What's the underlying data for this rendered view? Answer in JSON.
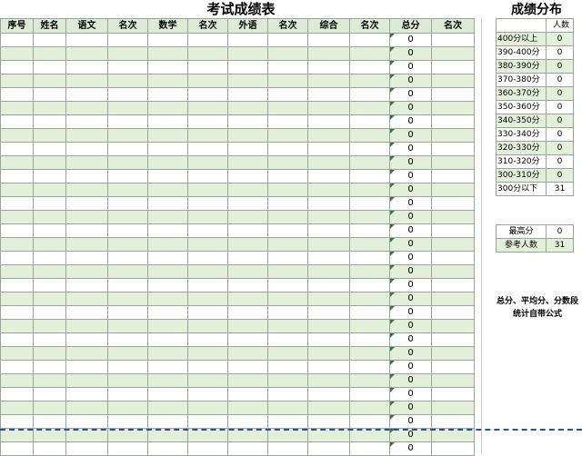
{
  "sheet": {
    "title": "考试成绩表",
    "headers": [
      "序号",
      "姓名",
      "语文",
      "名次",
      "数学",
      "名次",
      "外语",
      "名次",
      "综合",
      "名次",
      "总分",
      "名次"
    ],
    "total_value": "0",
    "row_count": 31
  },
  "distribution": {
    "title": "成绩分布",
    "count_header": "人数",
    "rows": [
      {
        "range": "400分以上",
        "count": "0"
      },
      {
        "range": "390-400分",
        "count": "0"
      },
      {
        "range": "380-390分",
        "count": "0"
      },
      {
        "range": "370-380分",
        "count": "0"
      },
      {
        "range": "360-370分",
        "count": "0"
      },
      {
        "range": "350-360分",
        "count": "0"
      },
      {
        "range": "340-350分",
        "count": "0"
      },
      {
        "range": "330-340分",
        "count": "0"
      },
      {
        "range": "320-330分",
        "count": "0"
      },
      {
        "range": "310-320分",
        "count": "0"
      },
      {
        "range": "300-310分",
        "count": "0"
      },
      {
        "range": "300分以下",
        "count": "31"
      }
    ]
  },
  "stats": {
    "max_label": "最高分",
    "max_value": "0",
    "participants_label": "参考人数",
    "participants_value": "31"
  },
  "note": "总分、平均分、分数段统计自带公式"
}
